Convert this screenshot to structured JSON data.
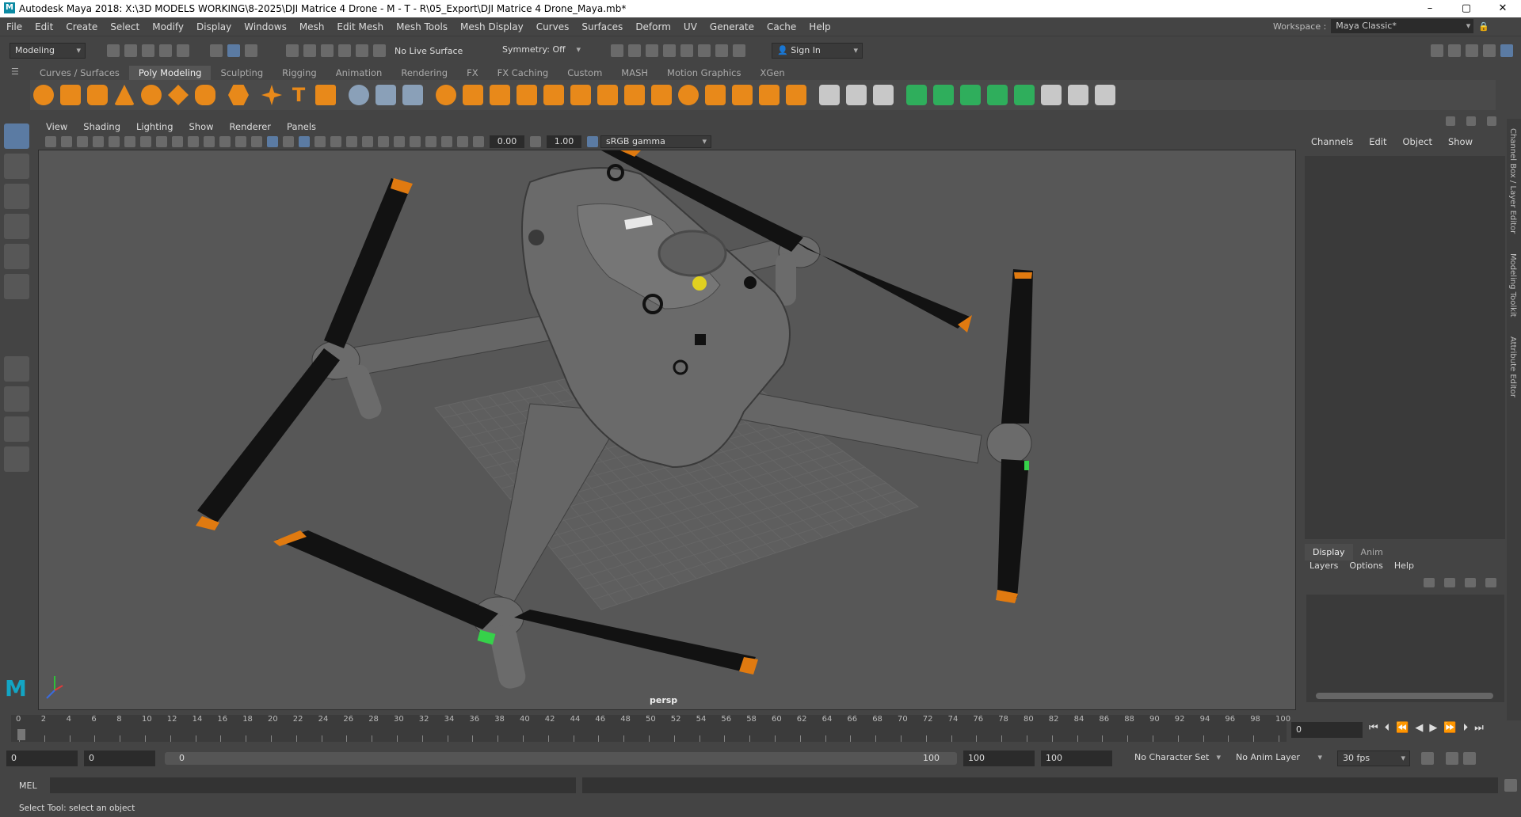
{
  "window": {
    "title": "Autodesk Maya 2018: X:\\3D MODELS WORKING\\8-2025\\DJI Matrice 4 Drone - M - T - R\\05_Export\\DJI Matrice 4 Drone_Maya.mb*",
    "logo": "M"
  },
  "menubar": {
    "items": [
      "File",
      "Edit",
      "Create",
      "Select",
      "Modify",
      "Display",
      "Windows",
      "Mesh",
      "Edit Mesh",
      "Mesh Tools",
      "Mesh Display",
      "Curves",
      "Surfaces",
      "Deform",
      "UV",
      "Generate",
      "Cache",
      "Help"
    ]
  },
  "workspace": {
    "label": "Workspace :",
    "value": "Maya Classic*"
  },
  "statusline": {
    "mode": "Modeling",
    "live_surface": "No Live Surface",
    "symmetry": "Symmetry: Off",
    "sign_in": "Sign In"
  },
  "shelf": {
    "tabs": [
      "Curves / Surfaces",
      "Poly Modeling",
      "Sculpting",
      "Rigging",
      "Animation",
      "Rendering",
      "FX",
      "FX Caching",
      "Custom",
      "MASH",
      "Motion Graphics",
      "XGen"
    ],
    "active_tab": "Poly Modeling"
  },
  "viewport": {
    "menus": [
      "View",
      "Shading",
      "Lighting",
      "Show",
      "Renderer",
      "Panels"
    ],
    "exposure": "0.00",
    "gamma": "1.00",
    "color_space": "sRGB gamma",
    "camera": "persp"
  },
  "channel_box": {
    "menus": [
      "Channels",
      "Edit",
      "Object",
      "Show"
    ]
  },
  "layer_editor": {
    "tabs": [
      "Display",
      "Anim"
    ],
    "active_tab": "Display",
    "menus": [
      "Layers",
      "Options",
      "Help"
    ]
  },
  "side_tabs": [
    "Channel Box / Layer Editor",
    "Modeling Toolkit",
    "Attribute Editor"
  ],
  "timeline": {
    "ticks": [
      "0",
      "2",
      "4",
      "6",
      "8",
      "10",
      "12",
      "14",
      "16",
      "18",
      "20",
      "22",
      "24",
      "26",
      "28",
      "30",
      "32",
      "34",
      "36",
      "38",
      "40",
      "42",
      "44",
      "46",
      "48",
      "50",
      "52",
      "54",
      "56",
      "58",
      "60",
      "62",
      "64",
      "66",
      "68",
      "70",
      "72",
      "74",
      "76",
      "78",
      "80",
      "82",
      "84",
      "86",
      "88",
      "90",
      "92",
      "94",
      "96",
      "98",
      "100"
    ],
    "current_frame": "0"
  },
  "range": {
    "start": "0",
    "anim_start": "0",
    "slider_start": "0",
    "slider_end": "100",
    "anim_end": "100",
    "end": "100",
    "character_set": "No Character Set",
    "anim_layer": "No Anim Layer",
    "fps": "30 fps"
  },
  "cmdline": {
    "label": "MEL"
  },
  "help_line": "Select Tool: select an object",
  "colors": {
    "accent": "#5b7ba3",
    "prop_orange": "#e07a10",
    "prop_black": "#121212",
    "drone_gray": "#5a5a5a",
    "grid": "#6a6a6a"
  }
}
